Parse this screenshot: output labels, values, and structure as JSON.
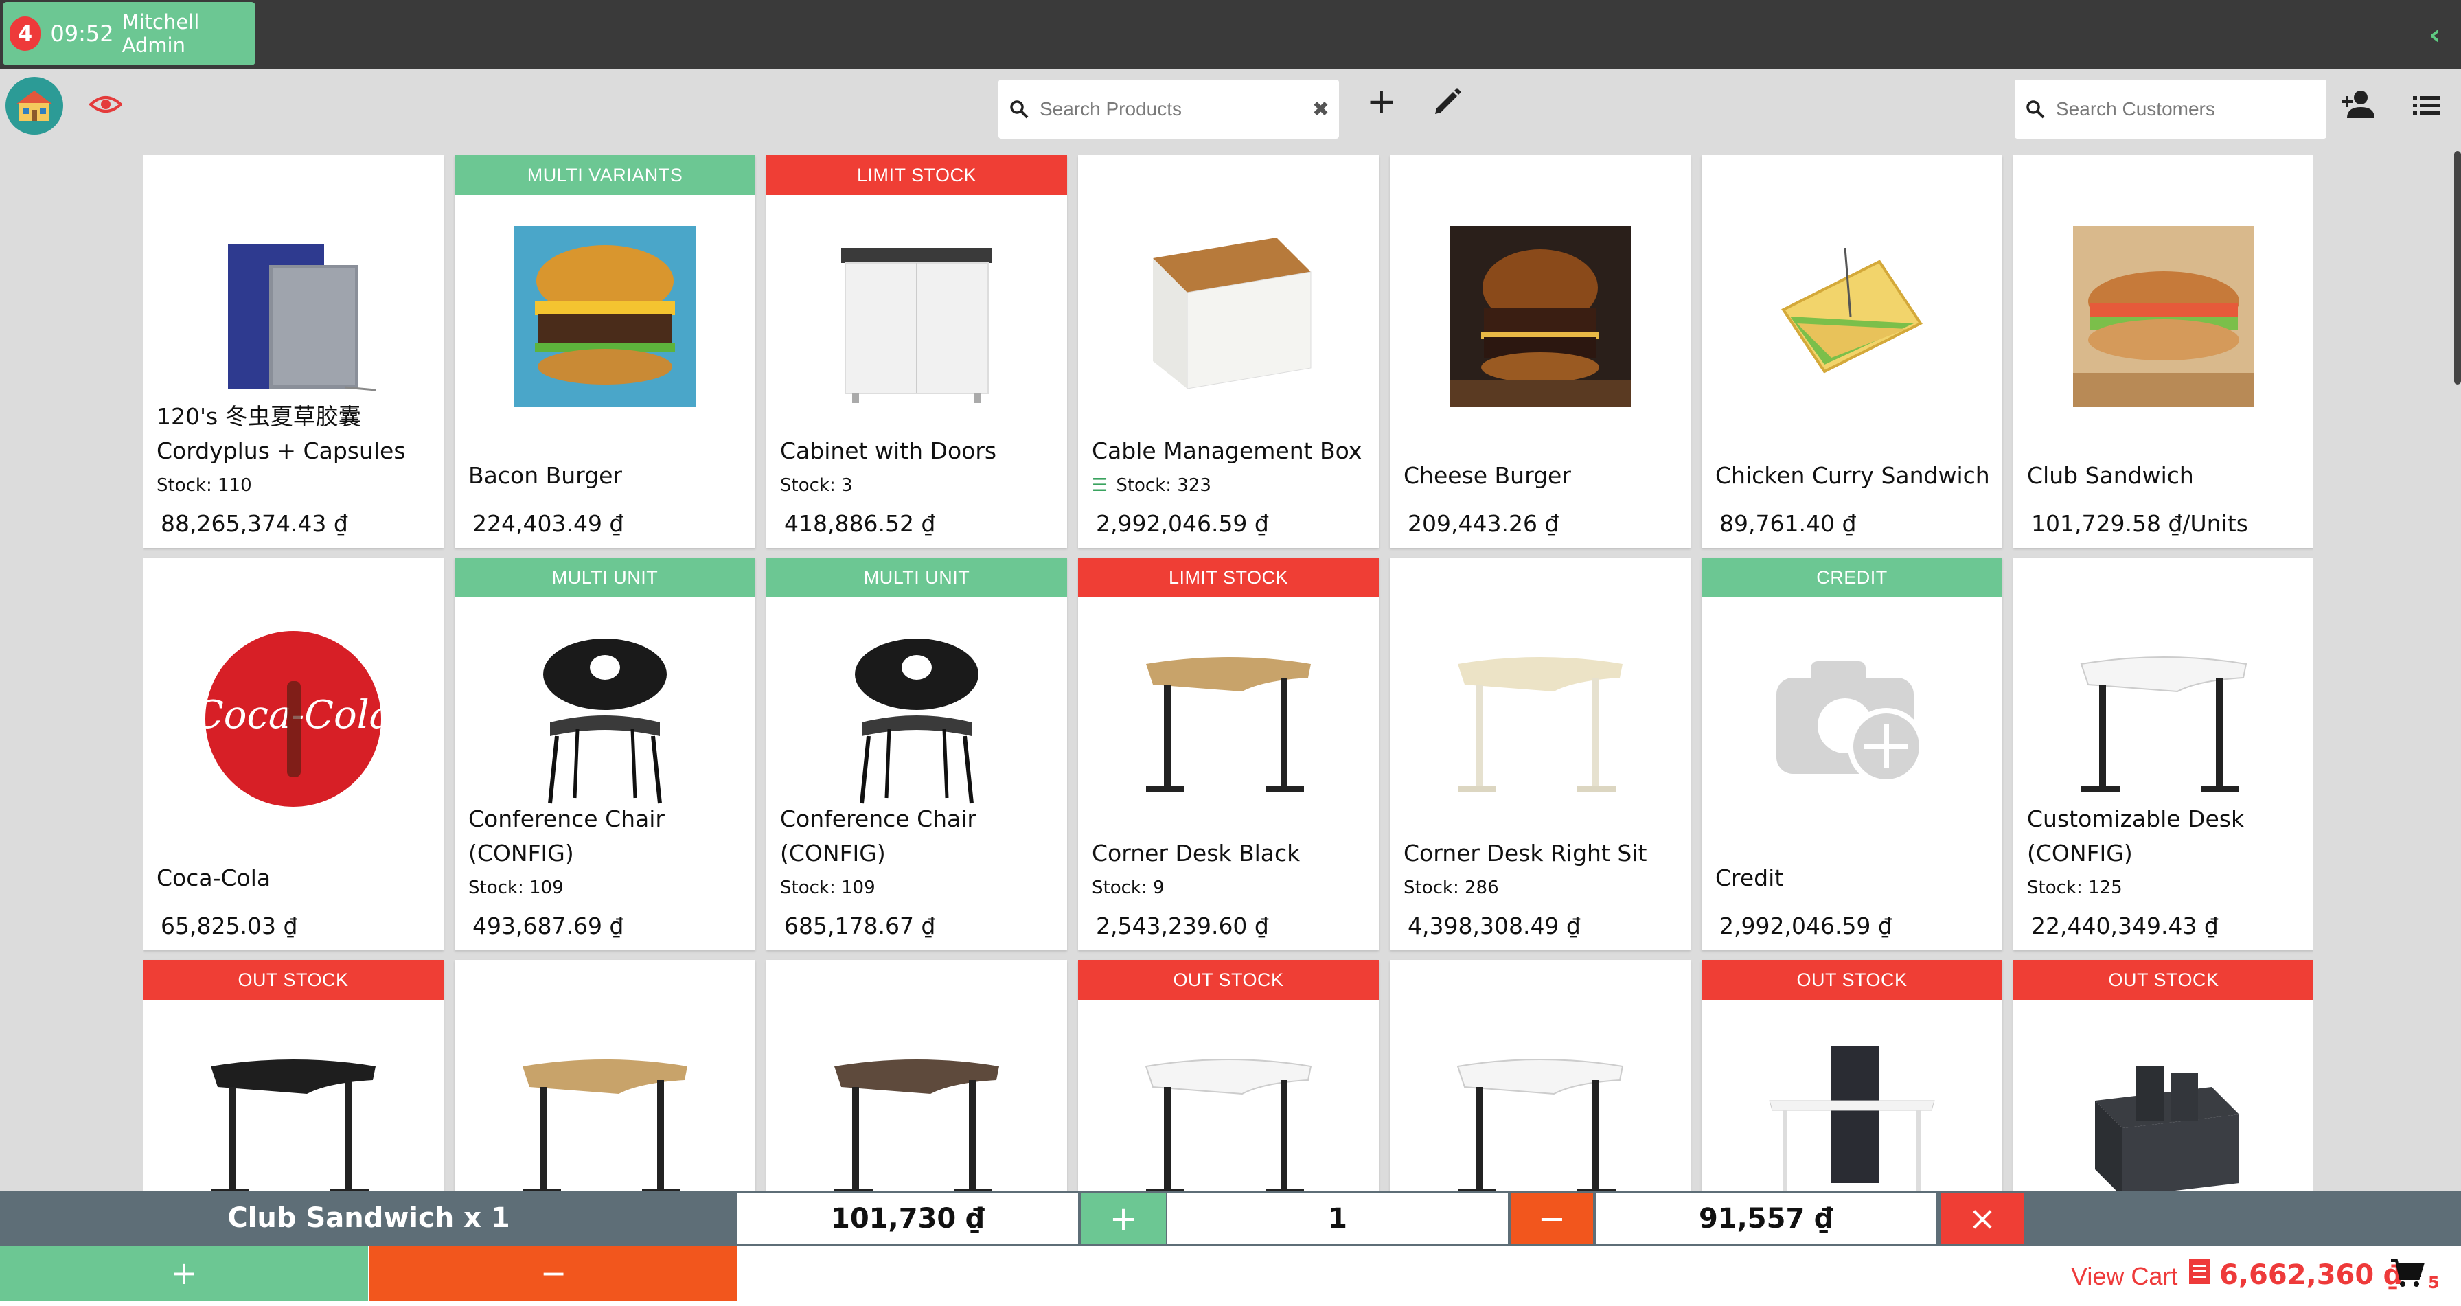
{
  "session": {
    "badge_count": "4",
    "time": "09:52",
    "user": "Mitchell Admin"
  },
  "search_products": {
    "placeholder": "Search Products"
  },
  "search_customers": {
    "placeholder": "Search Customers"
  },
  "icons": {
    "home": "home-icon",
    "eye": "eye-icon",
    "search": "search-icon",
    "clear": "close-icon",
    "add": "plus-icon",
    "edit": "pencil-icon",
    "add_customer": "add-user-icon",
    "list": "list-icon",
    "cart": "cart-icon",
    "receipt": "receipt-icon",
    "collapse": "chevron-left-icon"
  },
  "colors": {
    "green": "#6cc793",
    "red": "#ef3e35",
    "orange": "#f2561d",
    "topbar": "#3a3a3a",
    "orderline": "#5e6e77"
  },
  "products": [
    {
      "name": "120's 冬虫夏草胶囊 Cordyplus + Capsules",
      "stock": "Stock: 110",
      "price": "88,265,374.43 ₫",
      "ribbon": "",
      "image": "panel"
    },
    {
      "name": "Bacon Burger",
      "stock": "",
      "price": "224,403.49 ₫",
      "ribbon": "MULTI VARIANTS",
      "ribbon_color": "green",
      "image": "burger"
    },
    {
      "name": "Cabinet with Doors",
      "stock": "Stock: 3",
      "price": "418,886.52 ₫",
      "ribbon": "LIMIT STOCK",
      "ribbon_color": "red",
      "image": "cabinet"
    },
    {
      "name": "Cable Management Box",
      "stock": "Stock: 323",
      "price": "2,992,046.59 ₫",
      "ribbon": "",
      "image": "box",
      "stock_icon": true
    },
    {
      "name": "Cheese Burger",
      "stock": "",
      "price": "209,443.26 ₫",
      "ribbon": "",
      "image": "burger2"
    },
    {
      "name": "Chicken Curry Sandwich",
      "stock": "",
      "price": "89,761.40 ₫",
      "ribbon": "",
      "image": "sandwich"
    },
    {
      "name": "Club Sandwich",
      "stock": "",
      "price": "101,729.58 ₫/Units",
      "ribbon": "",
      "image": "club"
    },
    {
      "name": "Coca-Cola",
      "stock": "",
      "price": "65,825.03 ₫",
      "ribbon": "",
      "image": "coke"
    },
    {
      "name": "Conference Chair (CONFIG)",
      "stock": "Stock: 109",
      "price": "493,687.69 ₫",
      "ribbon": "MULTI UNIT",
      "ribbon_color": "green",
      "image": "chair"
    },
    {
      "name": "Conference Chair (CONFIG)",
      "stock": "Stock: 109",
      "price": "685,178.67 ₫",
      "ribbon": "MULTI UNIT",
      "ribbon_color": "green",
      "image": "chair"
    },
    {
      "name": "Corner Desk Black",
      "stock": "Stock: 9",
      "price": "2,543,239.60 ₫",
      "ribbon": "LIMIT STOCK",
      "ribbon_color": "red",
      "image": "desk-oak"
    },
    {
      "name": "Corner Desk Right Sit",
      "stock": "Stock: 286",
      "price": "4,398,308.49 ₫",
      "ribbon": "",
      "image": "desk-white"
    },
    {
      "name": "Credit",
      "stock": "",
      "price": "2,992,046.59 ₫",
      "ribbon": "CREDIT",
      "ribbon_color": "green",
      "image": "placeholder"
    },
    {
      "name": "Customizable Desk (CONFIG)",
      "stock": "Stock: 125",
      "price": "22,440,349.43 ₫",
      "ribbon": "",
      "image": "desk-plain"
    },
    {
      "name": "",
      "stock": "",
      "price": "",
      "ribbon": "OUT STOCK",
      "ribbon_color": "red",
      "image": "desk-black"
    },
    {
      "name": "",
      "stock": "",
      "price": "",
      "ribbon": "",
      "image": "desk-oak"
    },
    {
      "name": "",
      "stock": "",
      "price": "",
      "ribbon": "",
      "image": "desk-walnut"
    },
    {
      "name": "",
      "stock": "",
      "price": "",
      "ribbon": "OUT STOCK",
      "ribbon_color": "red",
      "image": "desk-plain"
    },
    {
      "name": "",
      "stock": "",
      "price": "",
      "ribbon": "",
      "image": "desk-plain"
    },
    {
      "name": "",
      "stock": "",
      "price": "",
      "ribbon": "OUT STOCK",
      "ribbon_color": "red",
      "image": "screen-desk"
    },
    {
      "name": "",
      "stock": "",
      "price": "",
      "ribbon": "OUT STOCK",
      "ribbon_color": "red",
      "image": "organizer"
    }
  ],
  "orderline": {
    "label": "Club Sandwich x 1",
    "price": "101,730 ₫",
    "plus": "+",
    "qty": "1",
    "minus": "−",
    "discounted": "91,557 ₫",
    "remove": "×"
  },
  "bottom": {
    "plus": "+",
    "minus": "−",
    "view_cart": "View Cart",
    "total": "6,662,360 ₫",
    "count": "5"
  }
}
